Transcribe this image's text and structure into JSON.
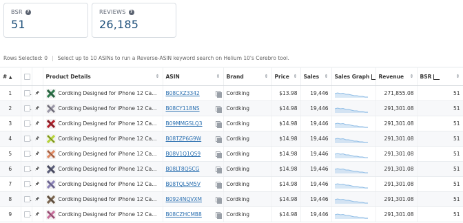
{
  "cards": [
    {
      "label": "BSR",
      "value": "51"
    },
    {
      "label": "REVIEWS",
      "value": "26,185"
    }
  ],
  "selection": {
    "rows_selected": "Rows Selected: 0",
    "hint": "Select up to 10 ASINs to run a Reverse-ASIN keyword search on Helium 10's Cerebro tool."
  },
  "columns": {
    "index": "#",
    "product": "Product Details",
    "asin": "ASIN",
    "brand": "Brand",
    "price": "Price",
    "sales": "Sales",
    "sales_graph": "Sales Graph",
    "revenue": "Revenue",
    "bsr": "BSR"
  },
  "rows": [
    {
      "idx": "1",
      "product": "Cordking Designed for iPhone 12 Ca...",
      "asin": "B08CXZ3342",
      "brand": "Cordking",
      "price": "$13.98",
      "sales": "19,446",
      "revenue": "271,855.08",
      "bsr": "51",
      "thumb": "#2f7a4d"
    },
    {
      "idx": "2",
      "product": "Cordking Designed for iPhone 12 Ca...",
      "asin": "B08CY118NS",
      "brand": "Cordking",
      "price": "$14.98",
      "sales": "19,446",
      "revenue": "291,301.08",
      "bsr": "51",
      "thumb": "#9b98a8"
    },
    {
      "idx": "3",
      "product": "Cordking Designed for iPhone 12 Ca...",
      "asin": "B09MMGSLQ3",
      "brand": "Cordking",
      "price": "$14.98",
      "sales": "19,446",
      "revenue": "291,301.08",
      "bsr": "51",
      "thumb": "#b4232e"
    },
    {
      "idx": "4",
      "product": "Cordking Designed for iPhone 12 Ca...",
      "asin": "B08TZP6G9W",
      "brand": "Cordking",
      "price": "$14.98",
      "sales": "19,446",
      "revenue": "291,301.08",
      "bsr": "51",
      "thumb": "#b6d43a"
    },
    {
      "idx": "5",
      "product": "Cordking Designed for iPhone 12 Ca...",
      "asin": "B08V1Q1QS9",
      "brand": "Cordking",
      "price": "$14.98",
      "sales": "19,446",
      "revenue": "291,301.08",
      "bsr": "51",
      "thumb": "#e08a63"
    },
    {
      "idx": "6",
      "product": "Cordking Designed for iPhone 12 Ca...",
      "asin": "B08LT8QSCG",
      "brand": "Cordking",
      "price": "$14.98",
      "sales": "19,446",
      "revenue": "291,301.08",
      "bsr": "51",
      "thumb": "#5b5e7a"
    },
    {
      "idx": "7",
      "product": "Cordking Designed for iPhone 12 Ca...",
      "asin": "B08TQL5M5V",
      "brand": "Cordking",
      "price": "$14.98",
      "sales": "19,446",
      "revenue": "291,301.08",
      "bsr": "51",
      "thumb": "#8c83b8"
    },
    {
      "idx": "8",
      "product": "Cordking Designed for iPhone 12 Ca...",
      "asin": "B0924NQVXM",
      "brand": "Cordking",
      "price": "$14.98",
      "sales": "19,446",
      "revenue": "291,301.08",
      "bsr": "51",
      "thumb": "#7a6550"
    },
    {
      "idx": "9",
      "product": "Cordking Designed for iPhone 12 Ca...",
      "asin": "B08CZHCMB8",
      "brand": "Cordking",
      "price": "$14.98",
      "sales": "19,446",
      "revenue": "291,301.08",
      "bsr": "51",
      "thumb": "#c86f9c"
    }
  ],
  "colors": {
    "accent": "#1d4f7a",
    "link": "#2a6fb0",
    "spark": "#8fbde6"
  },
  "icons": {
    "help": "question-circle-icon",
    "sort": "sort-icon",
    "pin": "pin-icon",
    "copy": "copy-icon",
    "graph": "chart-icon"
  }
}
